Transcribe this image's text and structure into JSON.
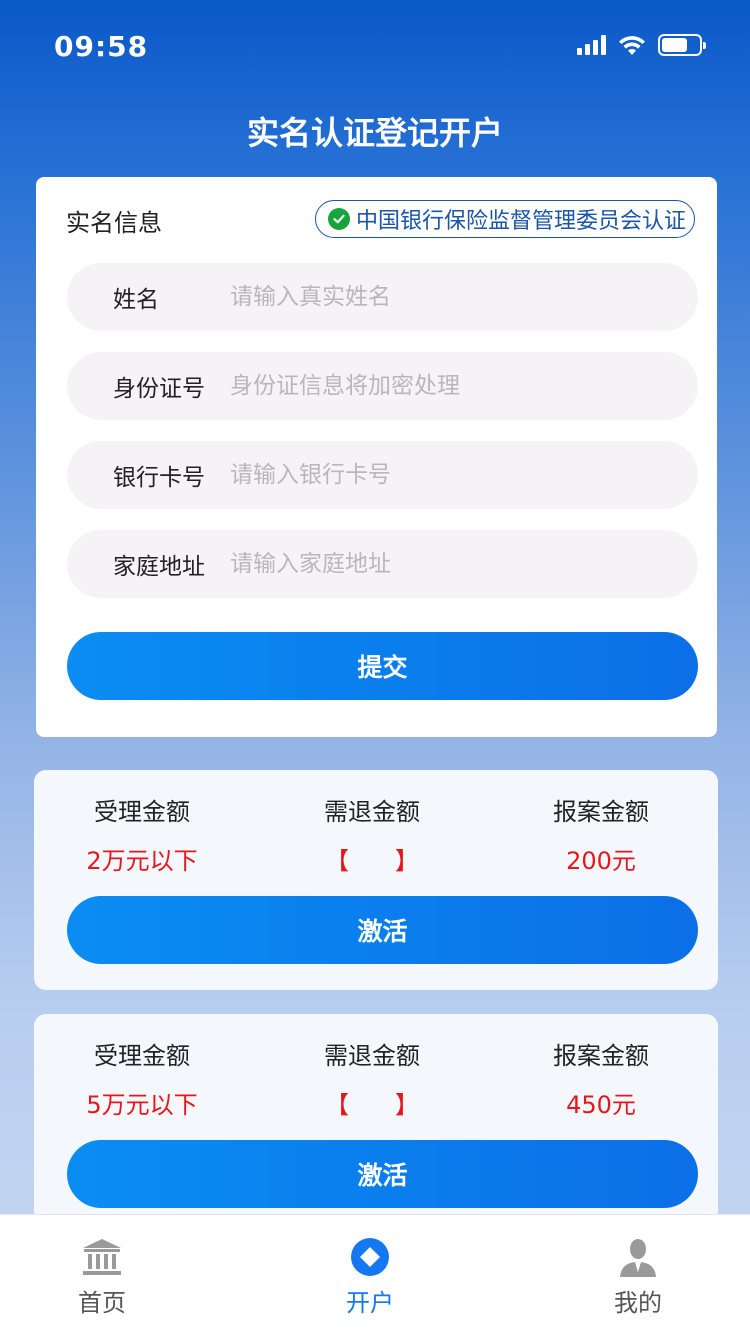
{
  "status_bar": {
    "time": "09:58"
  },
  "page": {
    "title": "实名认证登记开户"
  },
  "form": {
    "section_title": "实名信息",
    "cert_badge": "中国银行保险监督管理委员会认证",
    "fields": [
      {
        "label": "姓名",
        "placeholder": "请输入真实姓名",
        "value": ""
      },
      {
        "label": "身份证号",
        "placeholder": "身份证信息将加密处理",
        "value": ""
      },
      {
        "label": "银行卡号",
        "placeholder": "请输入银行卡号",
        "value": ""
      },
      {
        "label": "家庭地址",
        "placeholder": "请输入家庭地址",
        "value": ""
      }
    ],
    "submit_label": "提交"
  },
  "plans": [
    {
      "headers": [
        "受理金额",
        "需退金额",
        "报案金额"
      ],
      "values": [
        "2万元以下",
        "【      】",
        "200元"
      ],
      "button_label": "激活"
    },
    {
      "headers": [
        "受理金额",
        "需退金额",
        "报案金额"
      ],
      "values": [
        "5万元以下",
        "【      】",
        "450元"
      ],
      "button_label": "激活"
    }
  ],
  "tabs": [
    {
      "label": "首页",
      "icon": "bank-icon",
      "active": false
    },
    {
      "label": "开户",
      "icon": "diamond-circle-icon",
      "active": true
    },
    {
      "label": "我的",
      "icon": "user-icon",
      "active": false
    }
  ],
  "colors": {
    "accent": "#1677f2",
    "highlight_red": "#e8161b",
    "badge_blue": "#1a55a8",
    "check_green": "#19a33d"
  }
}
